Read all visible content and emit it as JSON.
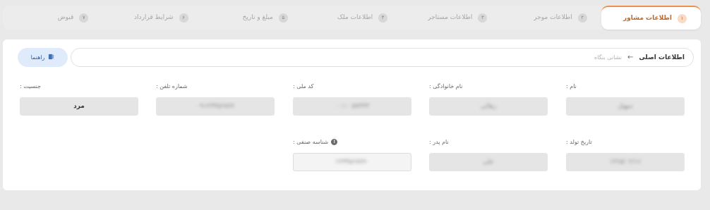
{
  "steps": [
    {
      "num": "۱",
      "label": "اطلاعات مشاور",
      "active": true
    },
    {
      "num": "۲",
      "label": "اطلاعات موجر",
      "active": false
    },
    {
      "num": "۳",
      "label": "اطلاعات مستاجر",
      "active": false
    },
    {
      "num": "۴",
      "label": "اطلاعات ملک",
      "active": false
    },
    {
      "num": "۵",
      "label": "مبلغ و تاریخ",
      "active": false
    },
    {
      "num": "۶",
      "label": "شرایط قرارداد",
      "active": false
    },
    {
      "num": "۷",
      "label": "قبوض",
      "active": false
    }
  ],
  "breadcrumb": {
    "main": "اطلاعات اصلی",
    "arrow": "←",
    "sub": "نشانی بنگاه"
  },
  "guide": {
    "label": "راهنما",
    "icon": "book-icon",
    "color": "#2f5fa8"
  },
  "fields": {
    "name": {
      "label": "نام :",
      "value": "سهیل"
    },
    "family": {
      "label": "نام خانوادگی :",
      "value": "رهائی"
    },
    "national_code": {
      "label": "کد ملی :",
      "value": "۰۰۱۰۰۵۷۳۳۳"
    },
    "phone": {
      "label": "شماره تلفن :",
      "value": "۰۹۱۲۳۴۵۶۷۸۹"
    },
    "gender": {
      "label": "جنسیت :",
      "value": "مرد"
    },
    "birth_date": {
      "label": "تاریخ تولد :",
      "value": "۱۳۶۵/۰۲/۱۶"
    },
    "father_name": {
      "label": "نام پدر :",
      "value": "علی"
    },
    "guild_id": {
      "label": "شناسه صنفی :",
      "value": "۱۲۳۴۵۶۷۸۹۰"
    }
  },
  "colors": {
    "accent": "#ef8f4e",
    "page_bg": "#e9e9ea",
    "card_bg": "#ffffff"
  }
}
